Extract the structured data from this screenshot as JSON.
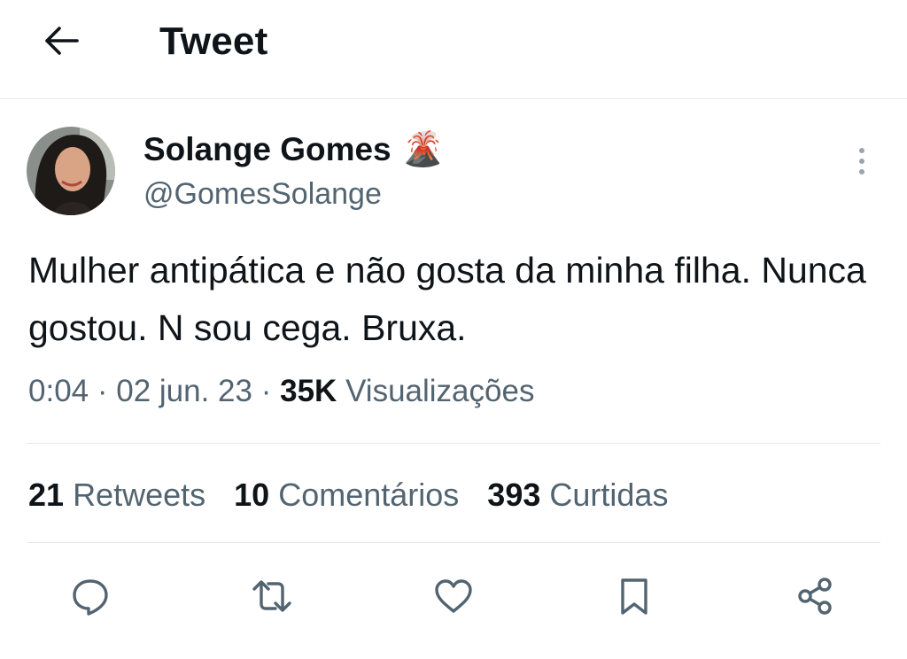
{
  "header": {
    "title": "Tweet",
    "back_icon": "arrow-left-icon"
  },
  "author": {
    "display_name": "Solange Gomes",
    "name_emoji": "🌋",
    "handle": "@GomesSolange",
    "avatar_icon": "avatar-photo"
  },
  "tweet": {
    "text": "Mulher antipática e não gosta da minha filha. Nunca gostou. N sou cega. Bruxa.",
    "time": "0:04",
    "date": "02 jun. 23",
    "views_count": "35K",
    "views_label": "Visualizações",
    "separator": "·"
  },
  "stats": {
    "retweets_count": "21",
    "retweets_label": "Retweets",
    "comments_count": "10",
    "comments_label": "Comentários",
    "likes_count": "393",
    "likes_label": "Curtidas"
  },
  "actions": [
    "reply-icon",
    "retweet-icon",
    "like-icon",
    "bookmark-icon",
    "share-icon"
  ],
  "colors": {
    "text": "#0f1419",
    "secondary": "#536471",
    "divider": "#e6e9ec",
    "icon": "#536471"
  }
}
